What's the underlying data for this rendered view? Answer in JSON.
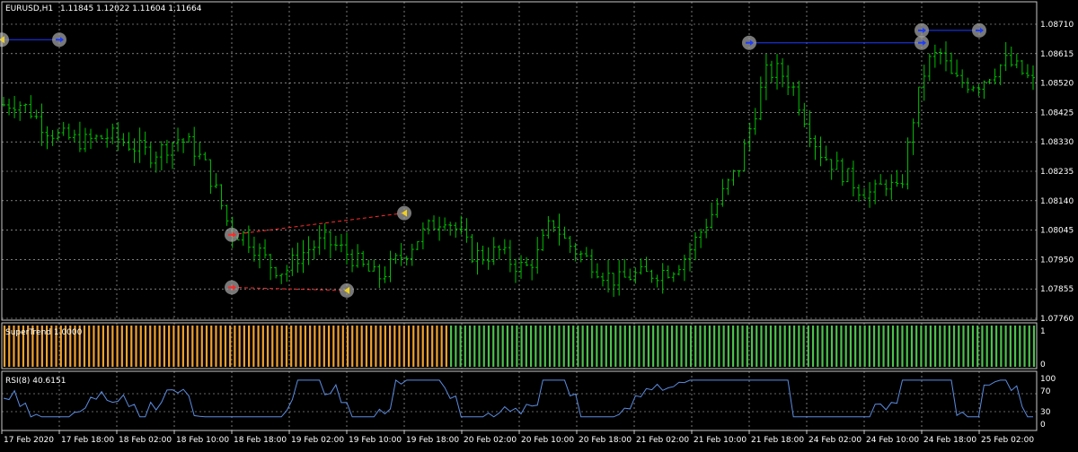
{
  "colors": {
    "background": "#000000",
    "grid": "#c8c8c8",
    "candle": "#00c000",
    "frame": "#c8c8c8",
    "text": "#ffffff",
    "supertrend_up": "#4ec04e",
    "supertrend_down": "#f0a030",
    "rsi_line": "#5b8ce0",
    "trade_buy": "#1c3cff",
    "trade_sell": "#ff2a2a",
    "marker_ring": "#a0a0a0",
    "marker_arrow": "#f0d020"
  },
  "icons": {
    "buy_marker": "blue-arrow-right-icon",
    "sell_marker": "red-arrow-right-icon",
    "close_marker": "yellow-arrow-left-icon"
  },
  "header": {
    "symbol_timeframe": "EURUSD,H1",
    "ohlc": "1.11845 1.12022 1.11604 1.11664"
  },
  "supertrend": {
    "label": "SuperTrend 1.0000",
    "axis_top": "1",
    "axis_bottom": "0",
    "switch_fraction": 0.43
  },
  "rsi": {
    "label": "RSI(8) 40.6151",
    "levels": [
      "100",
      "70",
      "30",
      "0"
    ]
  },
  "chart_data": {
    "type": "bar",
    "title": "EURUSD,H1",
    "price_ticks": [
      "1.08710",
      "1.08615",
      "1.08520",
      "1.08425",
      "1.08330",
      "1.08235",
      "1.08140",
      "1.08045",
      "1.07950",
      "1.07855",
      "1.07760"
    ],
    "ylim": [
      1.0776,
      1.0871
    ],
    "time_ticks": [
      "17 Feb 2020",
      "17 Feb 18:00",
      "18 Feb 02:00",
      "18 Feb 10:00",
      "18 Feb 18:00",
      "19 Feb 02:00",
      "19 Feb 10:00",
      "19 Feb 18:00",
      "20 Feb 02:00",
      "20 Feb 10:00",
      "20 Feb 18:00",
      "21 Feb 02:00",
      "21 Feb 10:00",
      "21 Feb 18:00",
      "24 Feb 02:00",
      "24 Feb 10:00",
      "24 Feb 18:00",
      "25 Feb 02:00"
    ],
    "close_series": [
      1.0845,
      1.0846,
      1.0843,
      1.0838,
      1.0835,
      1.0834,
      1.0833,
      1.0834,
      1.0835,
      1.0833,
      1.0831,
      1.0829,
      1.0831,
      1.0834,
      1.0832,
      1.0826,
      1.0816,
      1.0804,
      1.0803,
      1.0798,
      1.0793,
      1.0791,
      1.0796,
      1.0799,
      1.0801,
      1.0799,
      1.0796,
      1.0792,
      1.0789,
      1.0793,
      1.0797,
      1.0802,
      1.0806,
      1.0809,
      1.0804,
      1.0797,
      1.0796,
      1.0798,
      1.0794,
      1.0792,
      1.0797,
      1.0808,
      1.0801,
      1.0797,
      1.0794,
      1.079,
      1.0788,
      1.079,
      1.079,
      1.0791,
      1.0792,
      1.0796,
      1.0803,
      1.081,
      1.0818,
      1.0825,
      1.084,
      1.0855,
      1.0856,
      1.0851,
      1.084,
      1.083,
      1.0826,
      1.0822,
      1.0818,
      1.0816,
      1.082,
      1.0816,
      1.084,
      1.0858,
      1.0862,
      1.0853,
      1.0852,
      1.0852,
      1.0856,
      1.0859,
      1.0856,
      1.0852
    ],
    "trade_lines": [
      {
        "color": "blue",
        "from": [
          "17 Feb 2020",
          1.0866
        ],
        "to": [
          "17 Feb 18:00",
          1.0866
        ]
      },
      {
        "color": "blue",
        "from": [
          "21 Feb 18:00",
          1.0865
        ],
        "to": [
          "24 Feb 18:00",
          1.0865
        ]
      },
      {
        "color": "blue",
        "from": [
          "24 Feb 18:00",
          1.0869
        ],
        "to": [
          "25 Feb 02:00",
          1.0869
        ]
      },
      {
        "color": "red",
        "from": [
          "18 Feb 18:00",
          1.0803
        ],
        "to": [
          "19 Feb 18:00",
          1.081
        ]
      },
      {
        "color": "red",
        "from": [
          "18 Feb 18:00",
          1.0786
        ],
        "to": [
          "19 Feb 10:00",
          1.0785
        ]
      }
    ],
    "grid": true
  }
}
